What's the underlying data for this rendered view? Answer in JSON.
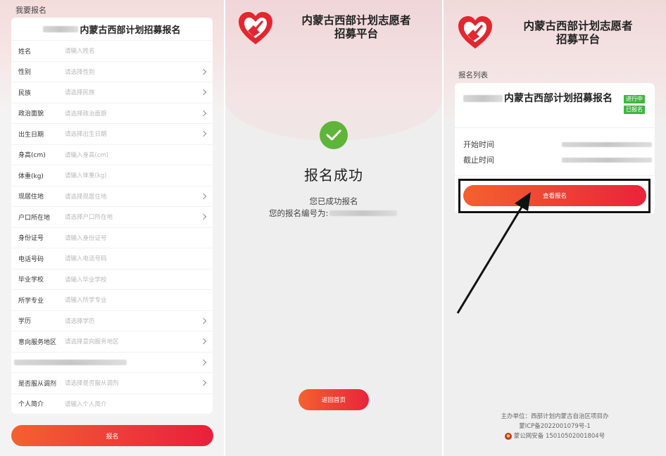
{
  "panel1": {
    "section_header": "我要报名",
    "form_title": "内蒙古西部计划招募报名",
    "fields": [
      {
        "label": "姓名",
        "placeholder": "请输入姓名",
        "chevron": false
      },
      {
        "label": "性别",
        "placeholder": "请选择性别",
        "chevron": true
      },
      {
        "label": "民族",
        "placeholder": "请选择民族",
        "chevron": true
      },
      {
        "label": "政治面貌",
        "placeholder": "请选择政治面貌",
        "chevron": true
      },
      {
        "label": "出生日期",
        "placeholder": "请选择出生日期",
        "chevron": true
      },
      {
        "label": "身高(cm)",
        "placeholder": "请输入身高(cm)",
        "chevron": false
      },
      {
        "label": "体重(kg)",
        "placeholder": "请输入体重(kg)",
        "chevron": false
      },
      {
        "label": "现居住地",
        "placeholder": "请选择现居住地",
        "chevron": true
      },
      {
        "label": "户口所在地",
        "placeholder": "请选择户口所在地",
        "chevron": true
      },
      {
        "label": "身份证号",
        "placeholder": "请输入身份证号",
        "chevron": false
      },
      {
        "label": "电话号码",
        "placeholder": "请输入电话号码",
        "chevron": false
      },
      {
        "label": "毕业学校",
        "placeholder": "请输入毕业学校",
        "chevron": false
      },
      {
        "label": "所学专业",
        "placeholder": "请输入所学专业",
        "chevron": false
      },
      {
        "label": "学历",
        "placeholder": "请选择学历",
        "chevron": true
      },
      {
        "label": "意向服务地区",
        "placeholder": "请选择意向服务地区",
        "chevron": true
      },
      {
        "label": "",
        "placeholder": "",
        "chevron": true,
        "blurred": true
      },
      {
        "label": "是否服从调剂",
        "placeholder": "请选择是否服从调剂",
        "chevron": true
      },
      {
        "label": "个人简介",
        "placeholder": "请输入个人简介",
        "chevron": false
      }
    ],
    "submit_label": "报名"
  },
  "panel2": {
    "platform_title_line1": "内蒙古西部计划志愿者",
    "platform_title_line2": "招募平台",
    "success_title": "报名成功",
    "success_message": "您已成功报名",
    "registration_no_label": "您的报名编号为:",
    "home_button": "返回首页"
  },
  "panel3": {
    "platform_title_line1": "内蒙古西部计划志愿者",
    "platform_title_line2": "招募平台",
    "list_label": "报名列表",
    "card_title": "内蒙古西部计划招募报名",
    "badge_status": "进行中",
    "badge_registered": "已报名",
    "start_label": "开始时间",
    "end_label": "截止时间",
    "view_button": "查看报名",
    "footer_line1": "主办单位：西部计划内蒙古自治区项目办",
    "footer_line2": "蒙ICP备2022001079号-1",
    "footer_line3": "蒙公网安备 15010502001804号"
  },
  "colors": {
    "accent_start": "#f4612f",
    "accent_end": "#e8203b",
    "success_green": "#5fb43a",
    "badge_green": "#3fb63f",
    "logo_red": "#e3262f"
  }
}
